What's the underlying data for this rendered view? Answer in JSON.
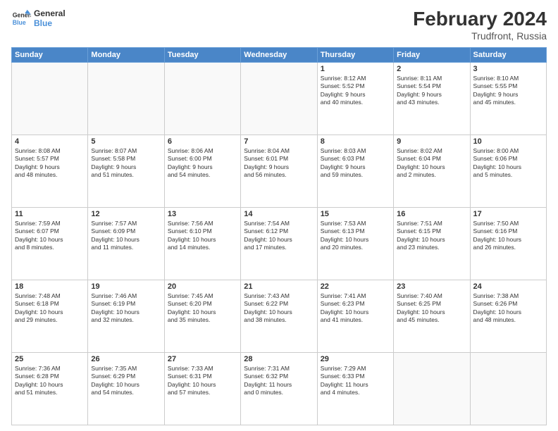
{
  "header": {
    "logo_line1": "General",
    "logo_line2": "Blue",
    "title": "February 2024",
    "subtitle": "Trudfront, Russia"
  },
  "days_of_week": [
    "Sunday",
    "Monday",
    "Tuesday",
    "Wednesday",
    "Thursday",
    "Friday",
    "Saturday"
  ],
  "weeks": [
    [
      {
        "day": "",
        "info": ""
      },
      {
        "day": "",
        "info": ""
      },
      {
        "day": "",
        "info": ""
      },
      {
        "day": "",
        "info": ""
      },
      {
        "day": "1",
        "info": "Sunrise: 8:12 AM\nSunset: 5:52 PM\nDaylight: 9 hours\nand 40 minutes."
      },
      {
        "day": "2",
        "info": "Sunrise: 8:11 AM\nSunset: 5:54 PM\nDaylight: 9 hours\nand 43 minutes."
      },
      {
        "day": "3",
        "info": "Sunrise: 8:10 AM\nSunset: 5:55 PM\nDaylight: 9 hours\nand 45 minutes."
      }
    ],
    [
      {
        "day": "4",
        "info": "Sunrise: 8:08 AM\nSunset: 5:57 PM\nDaylight: 9 hours\nand 48 minutes."
      },
      {
        "day": "5",
        "info": "Sunrise: 8:07 AM\nSunset: 5:58 PM\nDaylight: 9 hours\nand 51 minutes."
      },
      {
        "day": "6",
        "info": "Sunrise: 8:06 AM\nSunset: 6:00 PM\nDaylight: 9 hours\nand 54 minutes."
      },
      {
        "day": "7",
        "info": "Sunrise: 8:04 AM\nSunset: 6:01 PM\nDaylight: 9 hours\nand 56 minutes."
      },
      {
        "day": "8",
        "info": "Sunrise: 8:03 AM\nSunset: 6:03 PM\nDaylight: 9 hours\nand 59 minutes."
      },
      {
        "day": "9",
        "info": "Sunrise: 8:02 AM\nSunset: 6:04 PM\nDaylight: 10 hours\nand 2 minutes."
      },
      {
        "day": "10",
        "info": "Sunrise: 8:00 AM\nSunset: 6:06 PM\nDaylight: 10 hours\nand 5 minutes."
      }
    ],
    [
      {
        "day": "11",
        "info": "Sunrise: 7:59 AM\nSunset: 6:07 PM\nDaylight: 10 hours\nand 8 minutes."
      },
      {
        "day": "12",
        "info": "Sunrise: 7:57 AM\nSunset: 6:09 PM\nDaylight: 10 hours\nand 11 minutes."
      },
      {
        "day": "13",
        "info": "Sunrise: 7:56 AM\nSunset: 6:10 PM\nDaylight: 10 hours\nand 14 minutes."
      },
      {
        "day": "14",
        "info": "Sunrise: 7:54 AM\nSunset: 6:12 PM\nDaylight: 10 hours\nand 17 minutes."
      },
      {
        "day": "15",
        "info": "Sunrise: 7:53 AM\nSunset: 6:13 PM\nDaylight: 10 hours\nand 20 minutes."
      },
      {
        "day": "16",
        "info": "Sunrise: 7:51 AM\nSunset: 6:15 PM\nDaylight: 10 hours\nand 23 minutes."
      },
      {
        "day": "17",
        "info": "Sunrise: 7:50 AM\nSunset: 6:16 PM\nDaylight: 10 hours\nand 26 minutes."
      }
    ],
    [
      {
        "day": "18",
        "info": "Sunrise: 7:48 AM\nSunset: 6:18 PM\nDaylight: 10 hours\nand 29 minutes."
      },
      {
        "day": "19",
        "info": "Sunrise: 7:46 AM\nSunset: 6:19 PM\nDaylight: 10 hours\nand 32 minutes."
      },
      {
        "day": "20",
        "info": "Sunrise: 7:45 AM\nSunset: 6:20 PM\nDaylight: 10 hours\nand 35 minutes."
      },
      {
        "day": "21",
        "info": "Sunrise: 7:43 AM\nSunset: 6:22 PM\nDaylight: 10 hours\nand 38 minutes."
      },
      {
        "day": "22",
        "info": "Sunrise: 7:41 AM\nSunset: 6:23 PM\nDaylight: 10 hours\nand 41 minutes."
      },
      {
        "day": "23",
        "info": "Sunrise: 7:40 AM\nSunset: 6:25 PM\nDaylight: 10 hours\nand 45 minutes."
      },
      {
        "day": "24",
        "info": "Sunrise: 7:38 AM\nSunset: 6:26 PM\nDaylight: 10 hours\nand 48 minutes."
      }
    ],
    [
      {
        "day": "25",
        "info": "Sunrise: 7:36 AM\nSunset: 6:28 PM\nDaylight: 10 hours\nand 51 minutes."
      },
      {
        "day": "26",
        "info": "Sunrise: 7:35 AM\nSunset: 6:29 PM\nDaylight: 10 hours\nand 54 minutes."
      },
      {
        "day": "27",
        "info": "Sunrise: 7:33 AM\nSunset: 6:31 PM\nDaylight: 10 hours\nand 57 minutes."
      },
      {
        "day": "28",
        "info": "Sunrise: 7:31 AM\nSunset: 6:32 PM\nDaylight: 11 hours\nand 0 minutes."
      },
      {
        "day": "29",
        "info": "Sunrise: 7:29 AM\nSunset: 6:33 PM\nDaylight: 11 hours\nand 4 minutes."
      },
      {
        "day": "",
        "info": ""
      },
      {
        "day": "",
        "info": ""
      }
    ]
  ]
}
